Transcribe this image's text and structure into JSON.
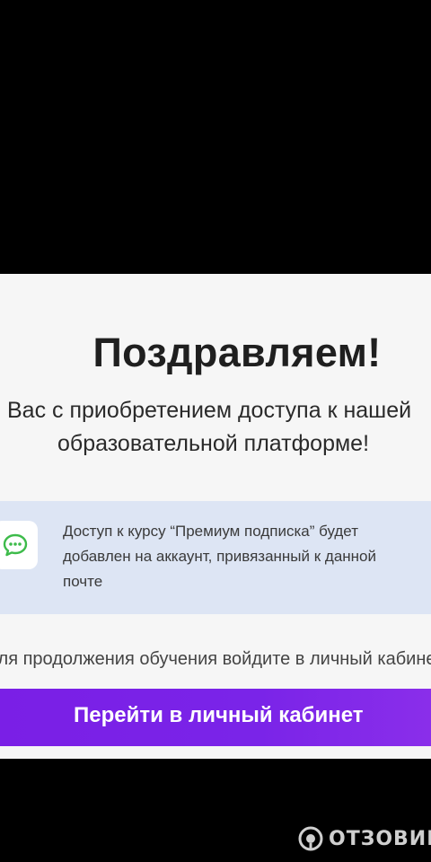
{
  "dialog": {
    "title": "Поздравляем!",
    "subtitle_line1": "Вас с приобретением доступа к нашей",
    "subtitle_line2": "образовательной платформе!"
  },
  "notice": {
    "icon": "chat-bubble-icon",
    "line1": "Доступ к курсу “Премиум подписка” будет",
    "line2": "добавлен на аккаунт, привязанный к данной",
    "line3": "почте"
  },
  "hint": "Для продолжения обучения войдите в личный кабинет",
  "cta": {
    "label": "Перейти в личный кабинет"
  },
  "watermark": {
    "text": "ОТЗОВИК"
  },
  "colors": {
    "background": "#000000",
    "card": "#f6f6f6",
    "notice": "#dde5f4",
    "accent": "#7a1fe6",
    "icon_green": "#3dbb4a"
  }
}
